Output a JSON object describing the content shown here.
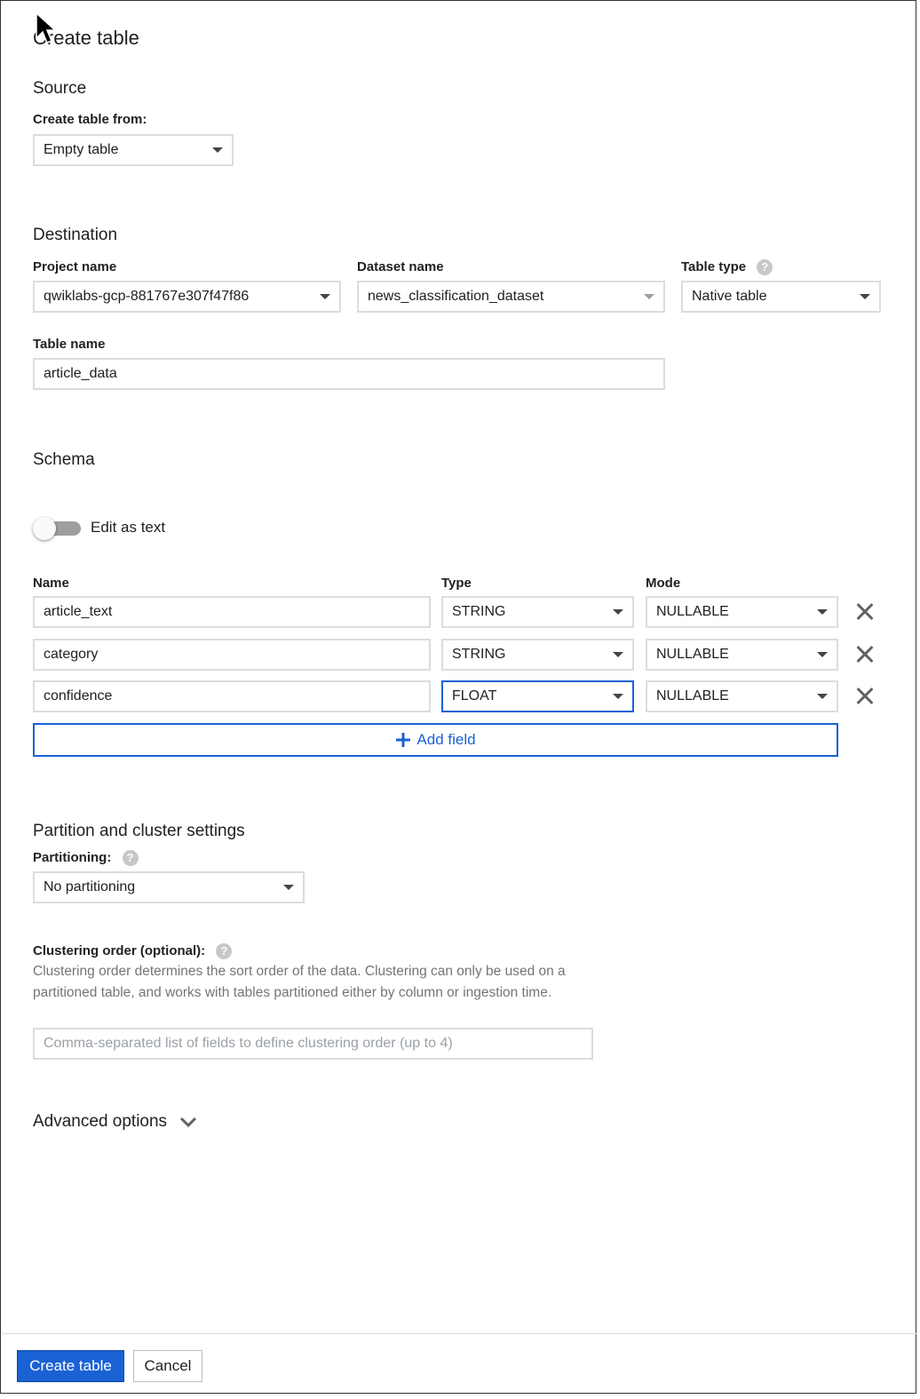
{
  "page": {
    "title": "Create table"
  },
  "source": {
    "heading": "Source",
    "create_from_label": "Create table from:",
    "create_from_value": "Empty table"
  },
  "destination": {
    "heading": "Destination",
    "project_label": "Project name",
    "project_value": "qwiklabs-gcp-881767e307f47f86",
    "dataset_label": "Dataset name",
    "dataset_value": "news_classification_dataset",
    "table_type_label": "Table type",
    "table_type_value": "Native table",
    "table_name_label": "Table name",
    "table_name_value": "article_data"
  },
  "schema": {
    "heading": "Schema",
    "edit_as_text_label": "Edit as text",
    "edit_as_text_on": false,
    "col_name": "Name",
    "col_type": "Type",
    "col_mode": "Mode",
    "fields": [
      {
        "name": "article_text",
        "type": "STRING",
        "mode": "NULLABLE"
      },
      {
        "name": "category",
        "type": "STRING",
        "mode": "NULLABLE"
      },
      {
        "name": "confidence",
        "type": "FLOAT",
        "mode": "NULLABLE"
      }
    ],
    "add_field_label": "Add field"
  },
  "partition": {
    "heading": "Partition and cluster settings",
    "partitioning_label": "Partitioning:",
    "partitioning_value": "No partitioning",
    "clustering_label": "Clustering order (optional):",
    "clustering_description": "Clustering order determines the sort order of the data. Clustering can only be used on a partitioned table, and works with tables partitioned either by column or ingestion time.",
    "clustering_placeholder": "Comma-separated list of fields to define clustering order (up to 4)"
  },
  "advanced": {
    "label": "Advanced options"
  },
  "footer": {
    "create_label": "Create table",
    "cancel_label": "Cancel"
  },
  "colors": {
    "accent": "#1a62d4",
    "border": "#dadce0",
    "text": "#202124",
    "muted": "#5f6368"
  },
  "icons": {
    "help": "help-circle-icon",
    "close": "close-icon",
    "add": "plus-icon",
    "expand": "chevron-down-icon",
    "dropdown": "caret-down-icon",
    "cursor": "mouse-pointer-icon"
  }
}
